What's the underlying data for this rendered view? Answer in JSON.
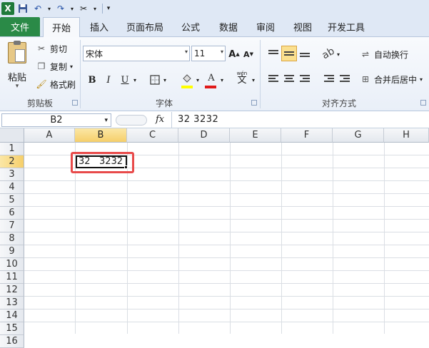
{
  "qat": {
    "icons": [
      "excel-logo",
      "save-icon",
      "undo-icon",
      "redo-icon",
      "customize-icon"
    ]
  },
  "tabs": [
    {
      "label": "文件"
    },
    {
      "label": "开始"
    },
    {
      "label": "插入"
    },
    {
      "label": "页面布局"
    },
    {
      "label": "公式"
    },
    {
      "label": "数据"
    },
    {
      "label": "审阅"
    },
    {
      "label": "视图"
    },
    {
      "label": "开发工具"
    }
  ],
  "clipboard": {
    "paste": "粘贴",
    "cut": "剪切",
    "copy": "复制",
    "format_painter": "格式刷",
    "group": "剪贴板"
  },
  "font": {
    "name": "宋体",
    "size": "11",
    "bold": "B",
    "italic": "I",
    "underline": "U",
    "font_color_letter": "A",
    "group": "字体",
    "highlight_color": "#ffff00",
    "font_color": "#e01a1a"
  },
  "alignment": {
    "wrap_text": "自动换行",
    "merge_center": "合并后居中",
    "group": "对齐方式"
  },
  "formula_bar": {
    "name_box": "B2",
    "fx": "fx",
    "content": "32   3232"
  },
  "grid": {
    "columns": [
      "A",
      "B",
      "C",
      "D",
      "E",
      "F",
      "G",
      "H"
    ],
    "rows": [
      "1",
      "2",
      "3",
      "4",
      "5",
      "6",
      "7",
      "8",
      "9",
      "10",
      "11",
      "12",
      "13",
      "14",
      "15",
      "16"
    ],
    "selected_cell": "B2",
    "b2_value": "32   3232"
  },
  "colors": {
    "file_tab": "#2a8a47",
    "highlight_box": "#e84a4a",
    "selection_header": "#f6cf6a"
  }
}
